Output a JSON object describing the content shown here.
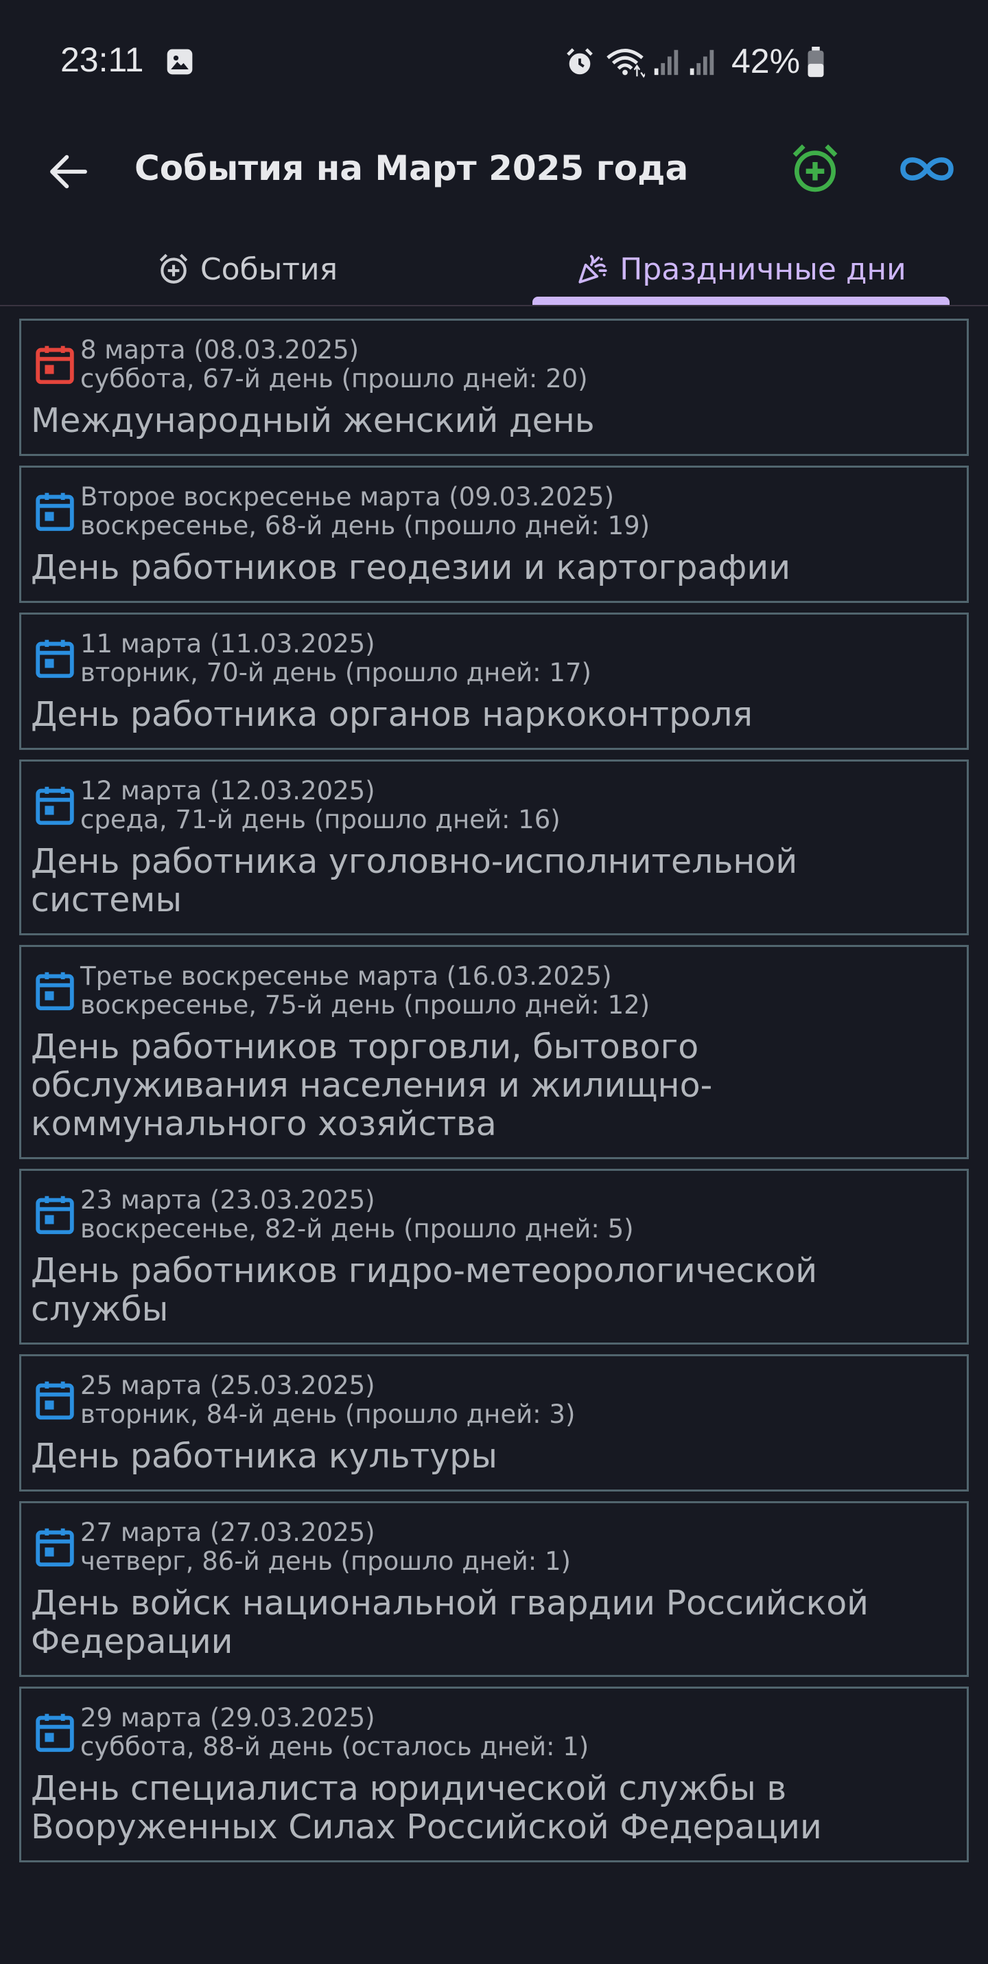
{
  "status_bar": {
    "time": "23:11",
    "battery": "42%",
    "icons": [
      "gallery-icon",
      "alarm-icon",
      "wifi-icon",
      "signal-icon",
      "signal-icon",
      "battery-icon"
    ]
  },
  "app_bar": {
    "title": "События на Март 2025 года",
    "icons": [
      "arrow-back-icon",
      "alarm-add-icon",
      "infinity-icon"
    ]
  },
  "tabs": [
    {
      "label": "События",
      "icon": "alarm-add-icon",
      "selected": false
    },
    {
      "label": "Праздничные дни",
      "icon": "party-popper-icon",
      "selected": true
    }
  ],
  "colors": {
    "background": "#171922",
    "card_border": "#51656e",
    "accent_tab": "#cdb6f7",
    "add_icon": "#3fae49",
    "infinity_icon": "#2f8fd8",
    "calendar_today": "#e5453c",
    "calendar_other": "#2a8fe0"
  },
  "items": [
    {
      "date": "8 марта (08.03.2025)",
      "day": "суббота, 67-й день (прошло дней: 20)",
      "title": "Международный женский день",
      "icon_color": "#e5453c"
    },
    {
      "date": "Второе воскресенье марта (09.03.2025)",
      "day": "воскресенье, 68-й день (прошло дней: 19)",
      "title": "День работников геодезии и картографии",
      "icon_color": "#2a8fe0"
    },
    {
      "date": "11 марта (11.03.2025)",
      "day": "вторник, 70-й день (прошло дней: 17)",
      "title": "День работника органов наркоконтроля",
      "icon_color": "#2a8fe0"
    },
    {
      "date": "12 марта (12.03.2025)",
      "day": "среда, 71-й день (прошло дней: 16)",
      "title": "День работника уголовно-исполнительной системы",
      "icon_color": "#2a8fe0"
    },
    {
      "date": "Третье воскресенье марта (16.03.2025)",
      "day": "воскресенье, 75-й день (прошло дней: 12)",
      "title": "День работников торговли, бытового обслуживания населения и жилищно-коммунального хозяйства",
      "icon_color": "#2a8fe0"
    },
    {
      "date": "23 марта (23.03.2025)",
      "day": "воскресенье, 82-й день (прошло дней: 5)",
      "title": "День работников гидро-метеорологической службы",
      "icon_color": "#2a8fe0"
    },
    {
      "date": "25 марта (25.03.2025)",
      "day": "вторник, 84-й день (прошло дней: 3)",
      "title": "День работника культуры",
      "icon_color": "#2a8fe0"
    },
    {
      "date": "27 марта (27.03.2025)",
      "day": "четверг, 86-й день (прошло дней: 1)",
      "title": "День войск национальной гвардии Российской Федерации",
      "icon_color": "#2a8fe0"
    },
    {
      "date": "29 марта (29.03.2025)",
      "day": "суббота, 88-й день (осталось дней: 1)",
      "title": "День специалиста юридической службы в Вооруженных Силах Российской Федерации",
      "icon_color": "#2a8fe0"
    }
  ]
}
